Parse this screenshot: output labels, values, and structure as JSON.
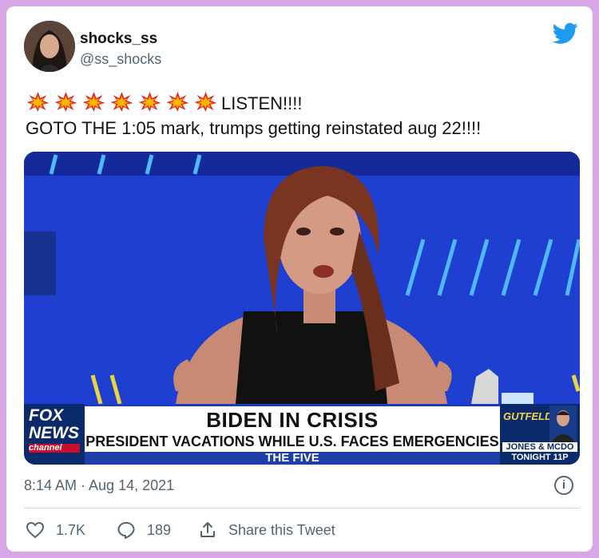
{
  "author": {
    "display_name": "shocks_ss",
    "handle": "@ss_shocks"
  },
  "tweet": {
    "emoji_prefix": "💥💥💥💥💥💥💥",
    "line1": "LISTEN!!!!",
    "line2": " GOTO THE 1:05 mark, trumps getting reinstated aug 22!!!!",
    "timestamp": "8:14 AM · Aug 14, 2021"
  },
  "media": {
    "logo_line1": "FOX",
    "logo_line2": "NEWS",
    "logo_line3": "channel",
    "headline": "BIDEN IN CRISIS",
    "subheadline": "PRESIDENT VACATIONS WHILE U.S. FACES EMERGENCIES",
    "show_name": "THE FIVE",
    "side_brand": "GUTFELD!",
    "side_line1": "JONES & MCDO",
    "side_line2": "TONIGHT 11P"
  },
  "actions": {
    "likes": "1.7K",
    "replies": "189",
    "share_label": "Share this Tweet"
  },
  "icons": {
    "brand": "twitter-bird-icon",
    "info": "info-icon",
    "like": "heart-icon",
    "reply": "reply-icon",
    "share": "share-icon",
    "emoji": "collision-emoji-icon"
  },
  "colors": {
    "page_border": "#d8a6e6",
    "twitter_blue": "#1d9bf0",
    "muted_text": "#536471"
  }
}
